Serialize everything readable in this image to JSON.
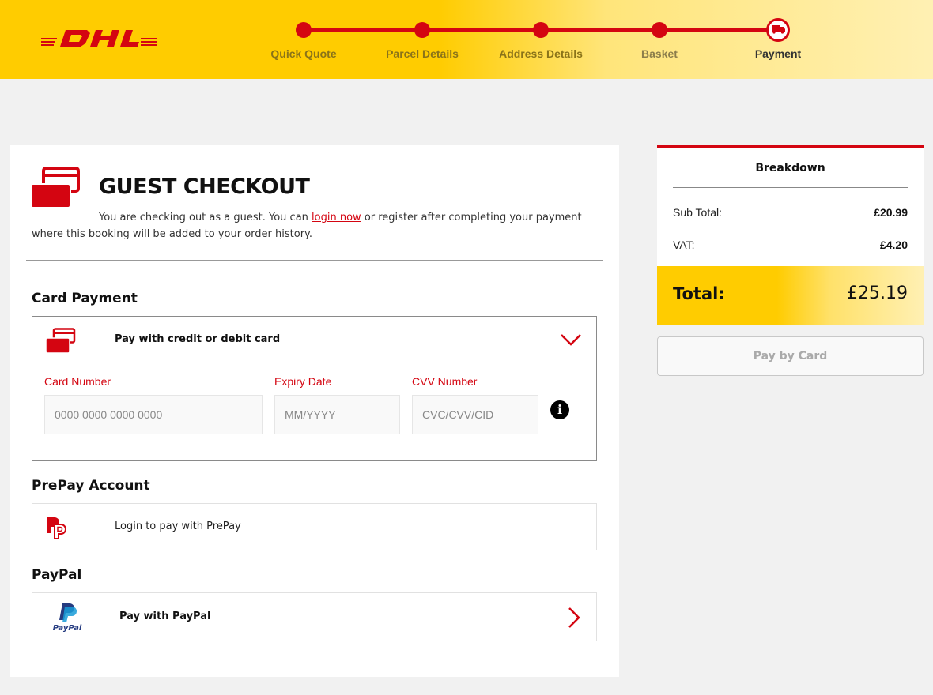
{
  "header": {
    "brand": "DHL",
    "colors": {
      "brand_yellow": "#ffcc00",
      "brand_red": "#d40511"
    },
    "steps": [
      {
        "label": "Quick Quote",
        "state": "complete"
      },
      {
        "label": "Parcel Details",
        "state": "complete"
      },
      {
        "label": "Address Details",
        "state": "complete"
      },
      {
        "label": "Basket",
        "state": "complete"
      },
      {
        "label": "Payment",
        "state": "current",
        "icon": "truck-icon"
      }
    ]
  },
  "guest_checkout": {
    "icon": "credit-cards-icon",
    "title": "GUEST CHECKOUT",
    "text_before_link": "You are checking out as a guest. You can ",
    "link_text": "login now",
    "text_after_link": " or register after completing your payment where this booking will be added to your order history."
  },
  "card_payment": {
    "section_title": "Card Payment",
    "panel_label": "Pay with credit or debit card",
    "fields": {
      "card_number": {
        "label": "Card Number",
        "placeholder": "0000 0000 0000 0000",
        "value": ""
      },
      "expiry_date": {
        "label": "Expiry Date",
        "placeholder": "MM/YYYY",
        "value": ""
      },
      "cvv": {
        "label": "CVV Number",
        "placeholder": "CVC/CVV/CID",
        "value": ""
      }
    },
    "info_icon_glyph": "i"
  },
  "prepay": {
    "section_title": "PrePay Account",
    "panel_label": "Login to pay with PrePay"
  },
  "paypal": {
    "section_title": "PayPal",
    "panel_label": "Pay with PayPal",
    "logo_text": "PayPal"
  },
  "breakdown": {
    "title": "Breakdown",
    "rows": [
      {
        "label": "Sub Total:",
        "value": "£20.99"
      },
      {
        "label": "VAT:",
        "value": "£4.20"
      }
    ],
    "total_label": "Total:",
    "total_value": "£25.19",
    "pay_button_label": "Pay by Card"
  }
}
